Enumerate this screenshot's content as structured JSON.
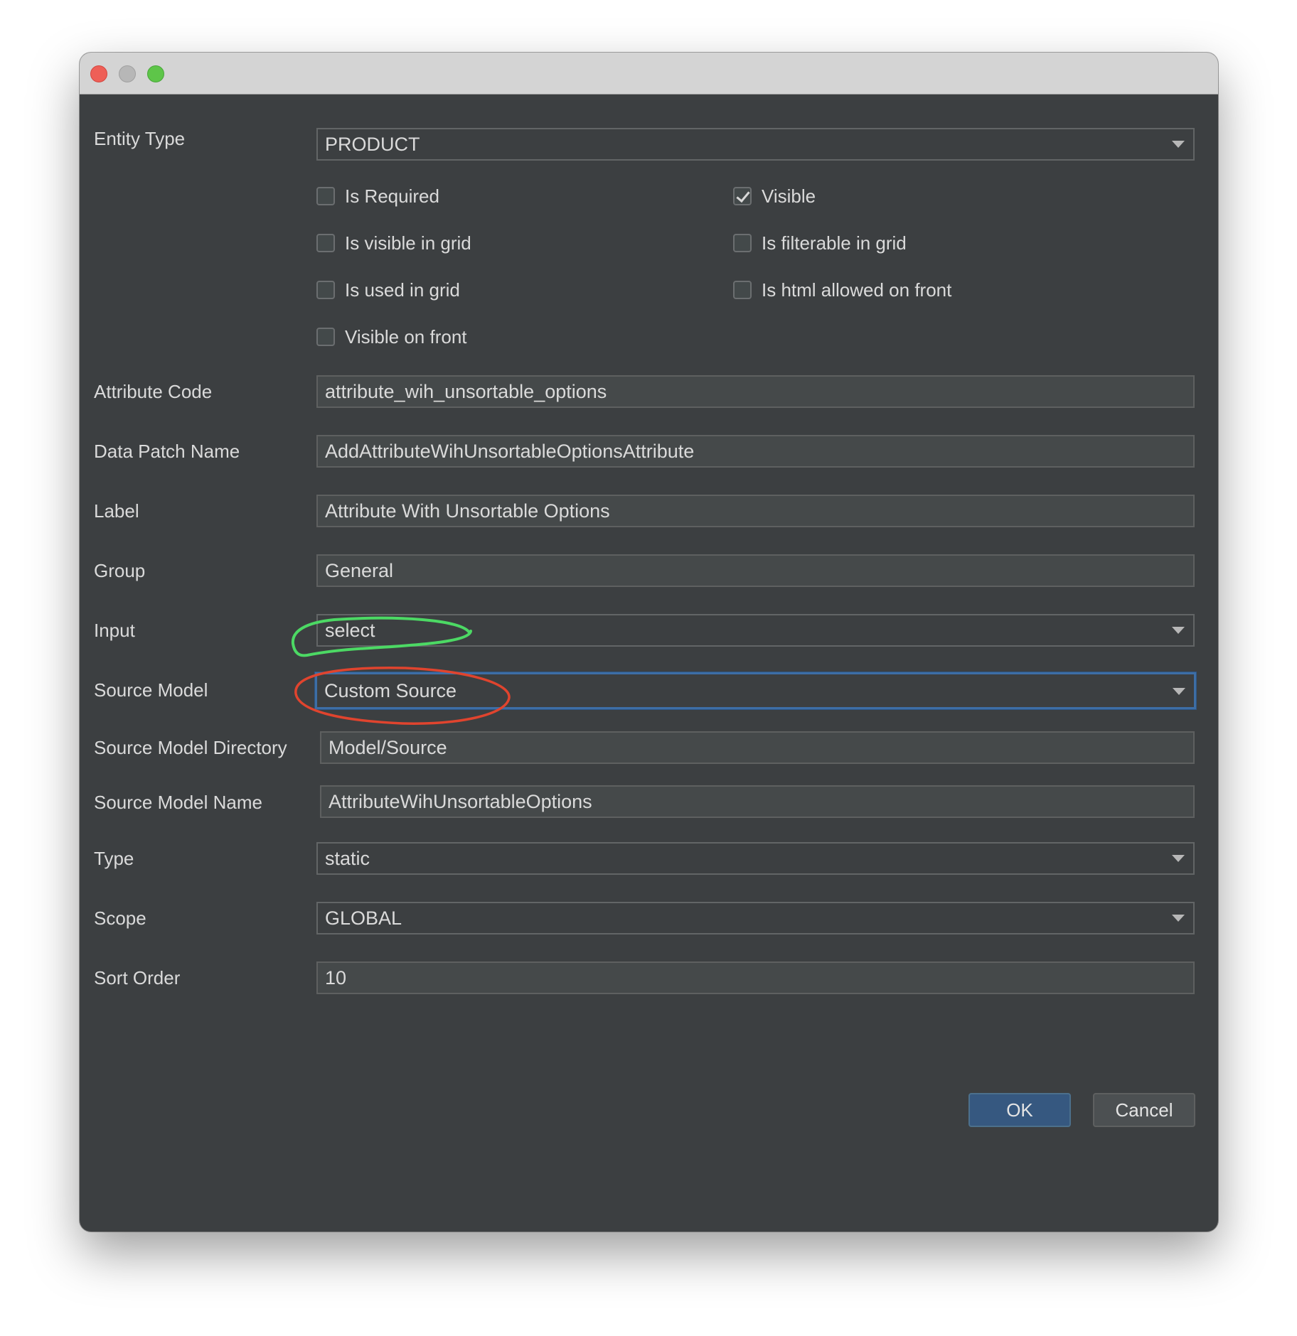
{
  "window": {
    "controls": {
      "close": "close-icon",
      "minimize": "minimize-icon",
      "zoom": "zoom-icon"
    }
  },
  "form": {
    "entity_type": {
      "label": "Entity Type",
      "value": "PRODUCT"
    },
    "checkboxes": {
      "is_required": {
        "label": "Is Required",
        "checked": false
      },
      "visible": {
        "label": "Visible",
        "checked": true
      },
      "is_visible_in_grid": {
        "label": "Is visible in grid",
        "checked": false
      },
      "is_filterable_in_grid": {
        "label": "Is filterable in grid",
        "checked": false
      },
      "is_used_in_grid": {
        "label": "Is used in grid",
        "checked": false
      },
      "is_html_allowed_on_front": {
        "label": "Is html allowed on front",
        "checked": false
      },
      "visible_on_front": {
        "label": "Visible on front",
        "checked": false
      }
    },
    "attribute_code": {
      "label": "Attribute Code",
      "value": "attribute_wih_unsortable_options"
    },
    "data_patch_name": {
      "label": "Data Patch Name",
      "value": "AddAttributeWihUnsortableOptionsAttribute"
    },
    "label": {
      "label": "Label",
      "value": "Attribute With Unsortable Options"
    },
    "group": {
      "label": "Group",
      "value": "General"
    },
    "input": {
      "label": "Input",
      "value": "select"
    },
    "source_model": {
      "label": "Source Model",
      "value": "Custom Source"
    },
    "source_model_directory": {
      "label": "Source Model Directory",
      "value": "Model/Source"
    },
    "source_model_name": {
      "label": "Source Model Name",
      "value": "AttributeWihUnsortableOptions"
    },
    "type": {
      "label": "Type",
      "value": "static"
    },
    "scope": {
      "label": "Scope",
      "value": "GLOBAL"
    },
    "sort_order": {
      "label": "Sort Order",
      "value": "10"
    }
  },
  "buttons": {
    "ok": "OK",
    "cancel": "Cancel"
  },
  "colors": {
    "background": "#3c3f41",
    "focus_border": "#3d6ea6",
    "primary_button": "#365880",
    "annotation_green": "#4cd964",
    "annotation_red": "#e0442e"
  }
}
